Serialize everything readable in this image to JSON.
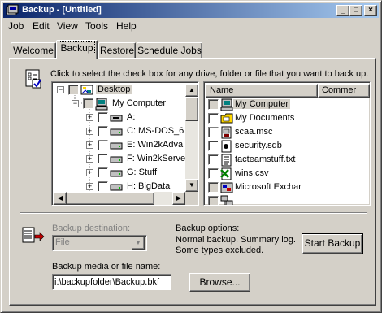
{
  "window": {
    "title": "Backup - [Untitled]",
    "buttons": {
      "minimize": "_",
      "maximize": "□",
      "close": "×"
    }
  },
  "menu": [
    "Job",
    "Edit",
    "View",
    "Tools",
    "Help"
  ],
  "tabs": [
    {
      "label": "Welcome",
      "active": false
    },
    {
      "label": "Backup",
      "active": true
    },
    {
      "label": "Restore",
      "active": false
    },
    {
      "label": "Schedule Jobs",
      "active": false
    }
  ],
  "instruction": "Click to select the check box for any drive, folder or file that you want to back up.",
  "tree": {
    "items": [
      {
        "label": "Desktop",
        "icon": "desktop-icon",
        "expander": "−",
        "level": 0,
        "selected": true
      },
      {
        "label": "My Computer",
        "icon": "computer-icon",
        "expander": "−",
        "level": 1
      },
      {
        "label": "A:",
        "icon": "floppy-drive-icon",
        "expander": "+",
        "level": 2
      },
      {
        "label": "C: MS-DOS_6",
        "icon": "hard-drive-icon",
        "expander": "+",
        "level": 2
      },
      {
        "label": "E: Win2kAdva",
        "icon": "hard-drive-icon",
        "expander": "+",
        "level": 2
      },
      {
        "label": "F: Win2kServe",
        "icon": "hard-drive-icon",
        "expander": "+",
        "level": 2
      },
      {
        "label": "G: Stuff",
        "icon": "hard-drive-icon",
        "expander": "+",
        "level": 2
      },
      {
        "label": "H: BigData",
        "icon": "hard-drive-icon",
        "expander": "+",
        "level": 2
      }
    ]
  },
  "list": {
    "columns": [
      "Name",
      "Commer"
    ],
    "items": [
      {
        "label": "My Computer",
        "icon": "computer-icon",
        "selected": true,
        "gray": true
      },
      {
        "label": "My Documents",
        "icon": "folder-icon"
      },
      {
        "label": "scaa.msc",
        "icon": "msc-file-icon"
      },
      {
        "label": "security.sdb",
        "icon": "sdb-file-icon"
      },
      {
        "label": "tacteamstuff.txt",
        "icon": "text-file-icon"
      },
      {
        "label": "wins.csv",
        "icon": "excel-file-icon"
      },
      {
        "label": "Microsoft Exchar",
        "icon": "exchange-icon",
        "gray": true
      },
      {
        "label": "",
        "icon": "network-icon",
        "gray": true
      }
    ]
  },
  "destination": {
    "label": "Backup destination:",
    "value": "File"
  },
  "options": {
    "label": "Backup options:",
    "line1": "Normal backup.  Summary log.",
    "line2": "Some types excluded."
  },
  "start_button": "Start Backup",
  "media": {
    "label": "Backup media or file name:",
    "value": "i:\\backupfolder\\Backup.bkf"
  },
  "browse_button": "Browse...",
  "colors": {
    "title_start": "#0a246a",
    "title_end": "#a6caf0",
    "selection": "#0a246a",
    "face": "#d4d0c8"
  }
}
